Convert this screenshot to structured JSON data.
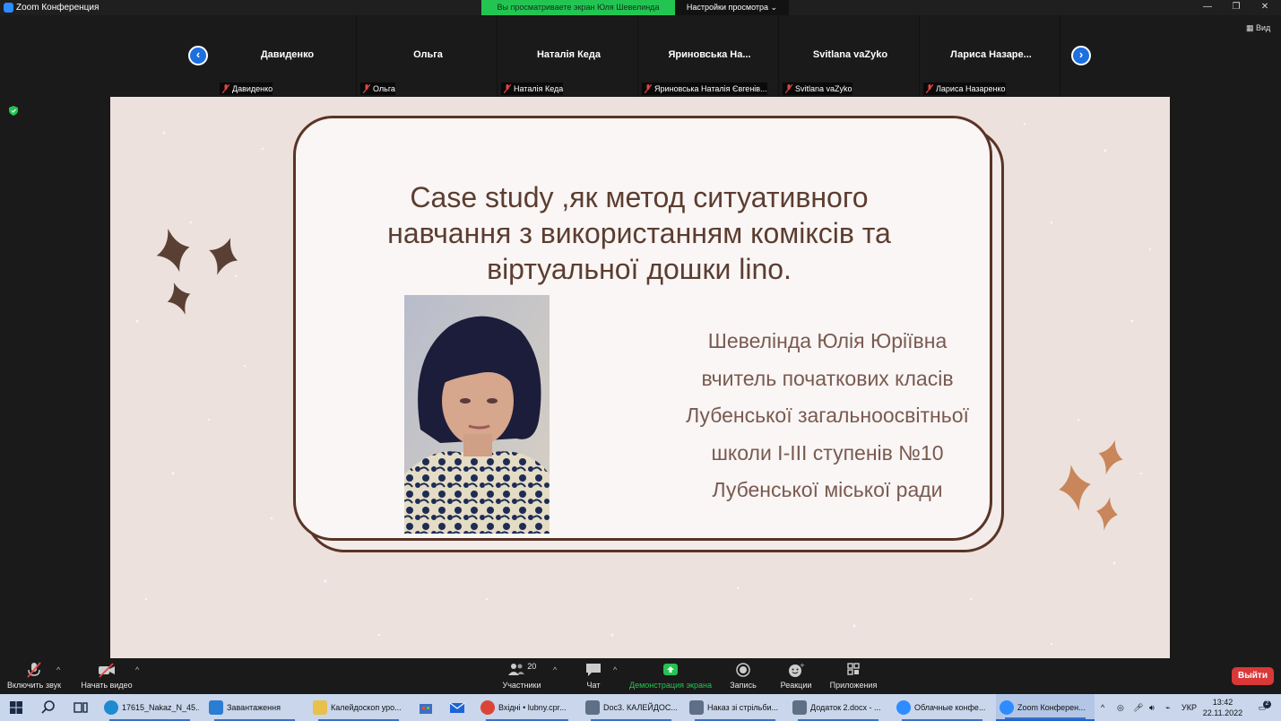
{
  "window": {
    "title": "Zoom Конференция",
    "share_banner": "Вы просматриваете экран Юля Шевелинда",
    "view_options": "Настройки просмотра",
    "view_button": "Вид"
  },
  "participants": [
    {
      "name": "Давиденко",
      "label": "Давиденко"
    },
    {
      "name": "Ольга",
      "label": "Ольга"
    },
    {
      "name": "Наталія Кеда",
      "label": "Наталія Кеда"
    },
    {
      "name": "Яриновська  На...",
      "label": "Яриновська Наталія Євгенів..."
    },
    {
      "name": "Svitlana vaZyko",
      "label": "Svitlana vaZyko"
    },
    {
      "name": "Лариса  Назаре...",
      "label": "Лариса Назаренко"
    }
  ],
  "slide": {
    "title_lines": [
      "Case study ,як метод ситуативного",
      "навчання з використанням коміксів та",
      "віртуальної дошки lino."
    ],
    "info_lines": [
      "Шевелінда Юлія Юріївна",
      "вчитель початкових класів",
      "Лубенської  загальноосвітньої",
      "школи І-ІІІ ступенів №10",
      "Лубенської міської ради"
    ]
  },
  "controls": {
    "mute": "Включить звук",
    "video": "Начать видео",
    "participants": "Участники",
    "participants_count": "20",
    "chat": "Чат",
    "share": "Демонстрация экрана",
    "record": "Запись",
    "reactions": "Реакции",
    "apps": "Приложения",
    "leave": "Выйти"
  },
  "taskbar": {
    "items": [
      {
        "label": "17615_Nakaz_N_45...",
        "icon": "edge-icon",
        "color": "#1e8bd0"
      },
      {
        "label": "Завантаження",
        "icon": "download-icon",
        "color": "#2b7cd3"
      },
      {
        "label": "Калейдоскоп уро...",
        "icon": "folder-icon",
        "color": "#e8c04c"
      },
      {
        "label": "Вхідні • lubny.cpr...",
        "icon": "chrome-icon",
        "color": "#db4437"
      },
      {
        "label": "Doc3. КАЛЕЙДОС...",
        "icon": "document-icon",
        "color": "#5f6f86"
      },
      {
        "label": "Наказ зі стрільби...",
        "icon": "document-icon",
        "color": "#5f6f86"
      },
      {
        "label": "Додаток 2.docx - ...",
        "icon": "document-icon",
        "color": "#5f6f86"
      },
      {
        "label": "Облачные конфе...",
        "icon": "zoom-icon",
        "color": "#2d8cff"
      },
      {
        "label": "Zoom Конферен...",
        "icon": "zoom-icon",
        "color": "#2d8cff"
      }
    ],
    "language": "УКР",
    "time": "13:42",
    "date": "22.11.2022",
    "notifications": "2"
  },
  "colors": {
    "zoom_blue": "#2d8cff",
    "share_green": "#23c552",
    "leave_red": "#d93838",
    "slide_background": "#ece1dd",
    "card_border": "#5a3426",
    "title_text": "#5c3d30",
    "sparkle_dark": "#5a4034",
    "sparkle_orange": "#c8865a"
  }
}
